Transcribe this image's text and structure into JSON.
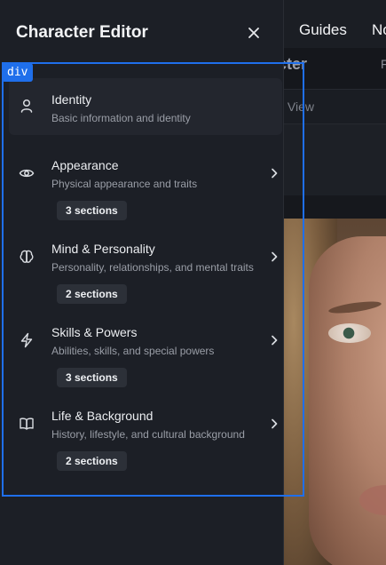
{
  "background": {
    "nav_links": [
      "Guides",
      "No"
    ],
    "page_title": "Edit Character",
    "page_title_suffix": "F",
    "view_label": "Side View"
  },
  "drawer": {
    "title": "Character Editor",
    "close_icon": "close-icon",
    "debug_badge": "div",
    "items": [
      {
        "label": "Identity",
        "description": "Basic information and identity",
        "icon": "user-icon",
        "active": true
      },
      {
        "label": "Appearance",
        "description": "Physical appearance and traits",
        "icon": "eye-icon",
        "badge": "3 sections"
      },
      {
        "label": "Mind & Personality",
        "description": "Personality, relationships, and mental traits",
        "icon": "brain-icon",
        "badge": "2 sections"
      },
      {
        "label": "Skills & Powers",
        "description": "Abilities, skills, and special powers",
        "icon": "lightning-icon",
        "badge": "3 sections"
      },
      {
        "label": "Life & Background",
        "description": "History, lifestyle, and cultural background",
        "icon": "book-icon",
        "badge": "2 sections"
      }
    ]
  },
  "colors": {
    "accent": "#1f6feb",
    "drawer_bg": "#1c1f26",
    "badge_bg": "#2c3038"
  }
}
